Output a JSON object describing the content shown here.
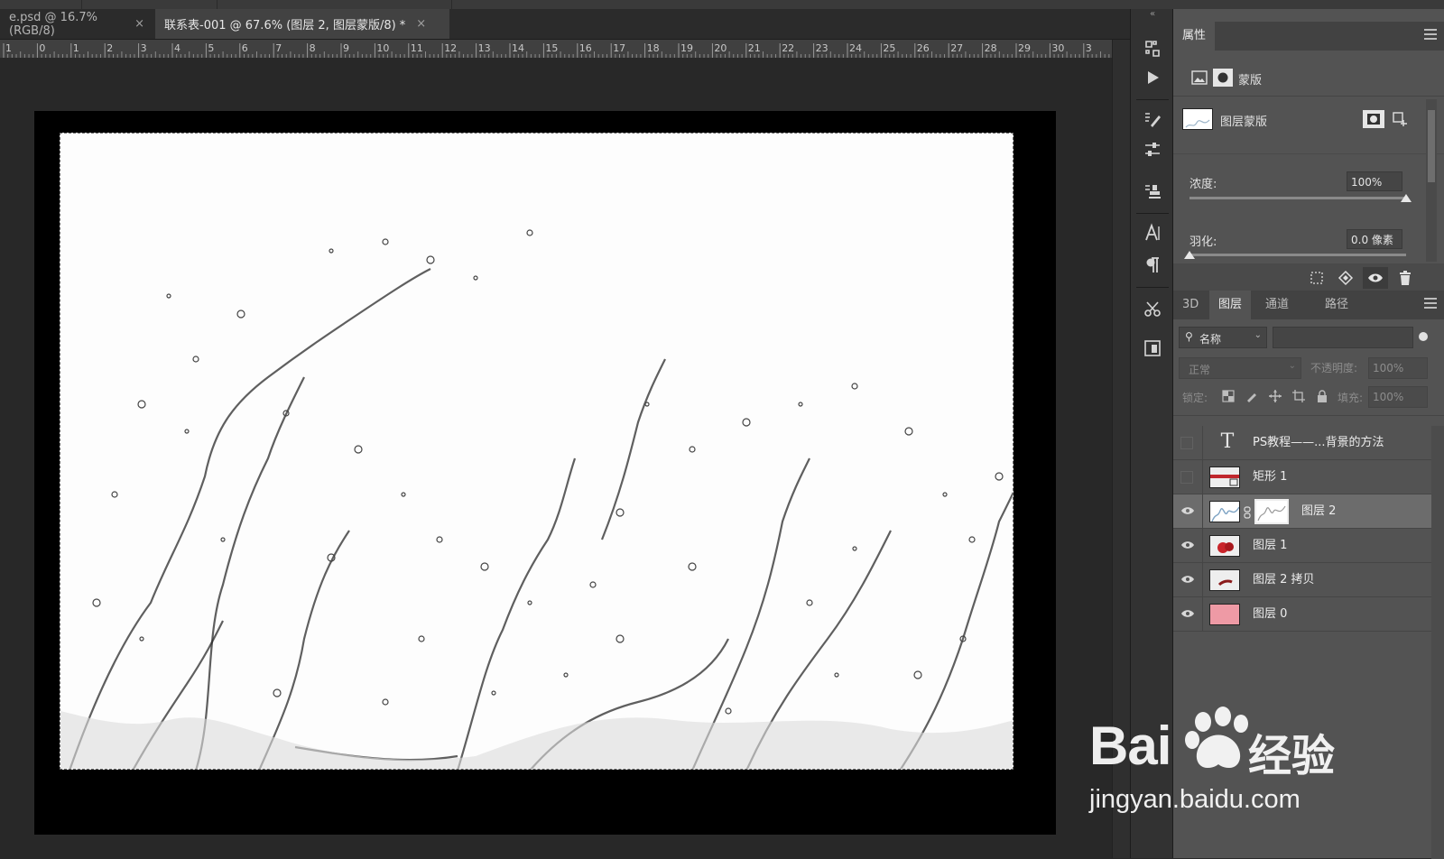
{
  "tabs": [
    {
      "label": "e.psd @ 16.7%(RGB/8)",
      "close": "×"
    },
    {
      "label": "联系表-001 @ 67.6% (图层 2, 图层蒙版/8) *",
      "close": "×"
    }
  ],
  "ruler": {
    "ticks": [
      "1",
      "0",
      "1",
      "2",
      "3",
      "4",
      "5",
      "6",
      "7",
      "8",
      "9",
      "10",
      "11",
      "12",
      "13",
      "14",
      "15",
      "16",
      "17",
      "18",
      "19",
      "20",
      "21",
      "22",
      "23",
      "24",
      "25",
      "26",
      "27",
      "28",
      "29",
      "30",
      "3"
    ]
  },
  "toolcolumn": {
    "collapse": "«"
  },
  "properties": {
    "tab": "属性",
    "mask_type": "蒙版",
    "layer_mask_label": "图层蒙版",
    "density_label": "浓度:",
    "density_value": "100%",
    "density": 1.0,
    "feather_label": "羽化:",
    "feather_value": "0.0 像素",
    "feather": 0.0
  },
  "layers_panel": {
    "tabs": [
      "3D",
      "图层",
      "通道",
      "路径"
    ],
    "active_tab": "图层",
    "filter_kind": "名称",
    "blend_mode": "正常",
    "opacity_label": "不透明度:",
    "opacity_value": "100%",
    "lock_label": "锁定:",
    "fill_label": "填充:",
    "fill_value": "100%",
    "layers": [
      {
        "name": "PS教程——...背景的方法",
        "kind": "text",
        "visible": false,
        "selected": false
      },
      {
        "name": "矩形 1",
        "kind": "shape",
        "visible": false,
        "selected": false
      },
      {
        "name": "图层 2",
        "kind": "masked",
        "visible": true,
        "selected": true
      },
      {
        "name": "图层 1",
        "kind": "pixel",
        "visible": true,
        "selected": false
      },
      {
        "name": "图层 2 拷贝",
        "kind": "pixel",
        "visible": true,
        "selected": false
      },
      {
        "name": "图层 0",
        "kind": "fill",
        "visible": true,
        "selected": false
      }
    ]
  },
  "watermark": {
    "brand_prefix": "Bai",
    "brand_suffix": "经验",
    "url": "jingyan.baidu.com"
  },
  "colors": {
    "accent": "#2f7bd6",
    "layer0": "#ee9aa5",
    "watermark": "#ffffff"
  }
}
